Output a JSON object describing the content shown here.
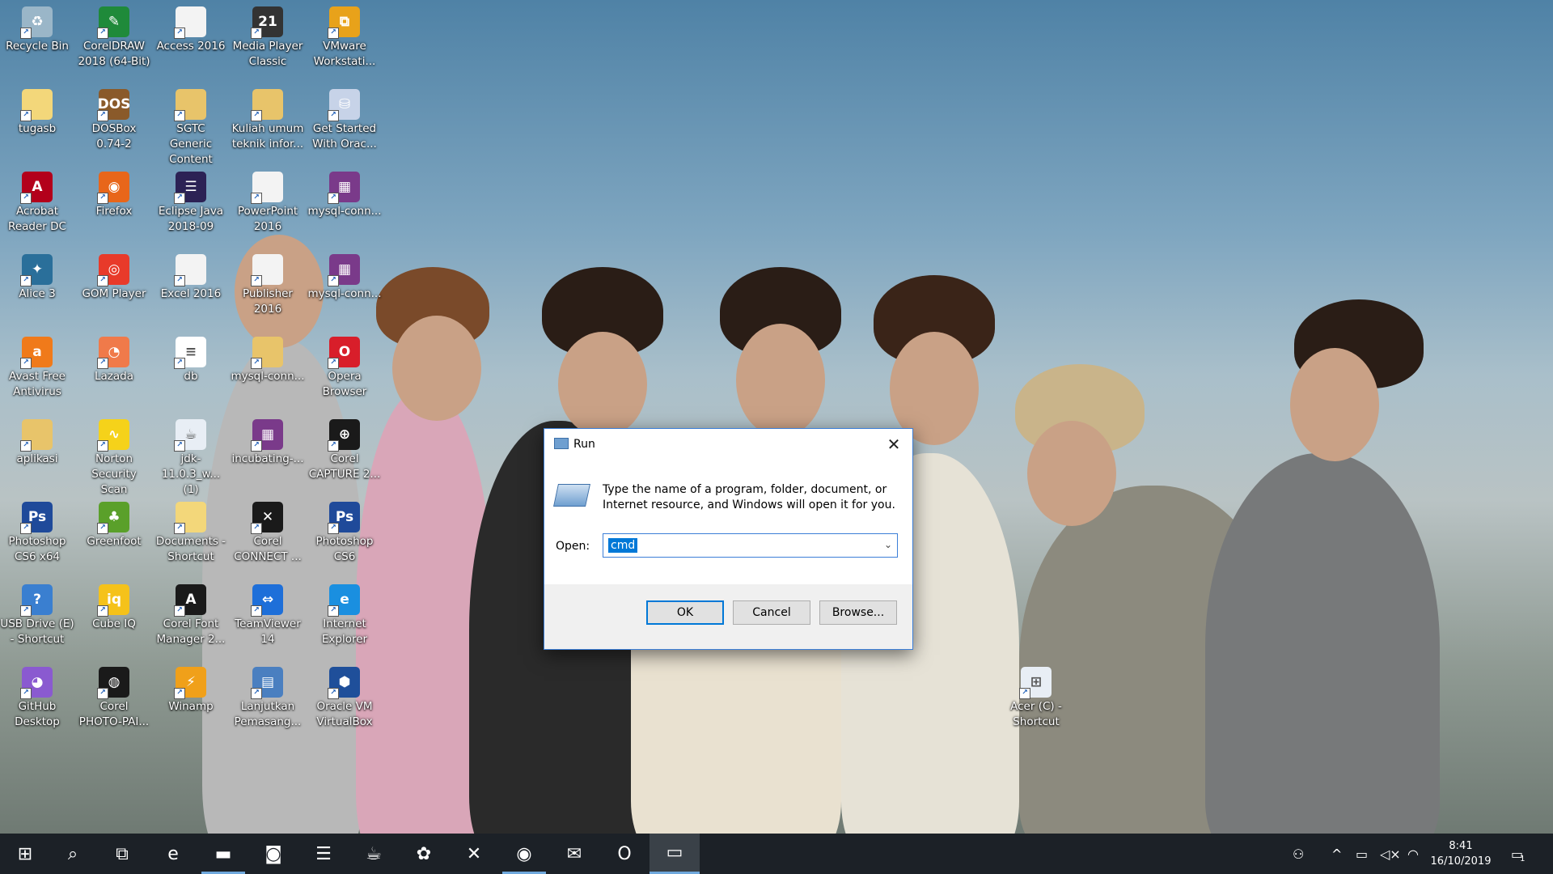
{
  "desktop_icons": [
    {
      "label": "Recycle Bin",
      "icon": "recycle-bin-icon",
      "color": "#9ab6c8",
      "glyph": "♻"
    },
    {
      "label": "CorelDRAW\n2018 (64-Bit)",
      "icon": "coreldraw-icon",
      "color": "#1f8a3a",
      "glyph": "✎"
    },
    {
      "label": "Access 2016",
      "icon": "document-icon",
      "color": "#f3f3f3",
      "glyph": ""
    },
    {
      "label": "Media Player\nClassic",
      "icon": "media-player-icon",
      "color": "#333333",
      "glyph": "21"
    },
    {
      "label": "VMware\nWorkstati...",
      "icon": "vmware-icon",
      "color": "#e8a21a",
      "glyph": "⧉"
    },
    {
      "label": "tugasb",
      "icon": "folder-icon",
      "color": "#f3d77a",
      "glyph": ""
    },
    {
      "label": "DOSBox\n0.74-2",
      "icon": "dosbox-icon",
      "color": "#8a5a2a",
      "glyph": "DOS"
    },
    {
      "label": "SGTC Generic\nContent",
      "icon": "archive-icon",
      "color": "#e8c46a",
      "glyph": ""
    },
    {
      "label": "Kuliah umum\nteknik infor...",
      "icon": "archive-icon",
      "color": "#e8c46a",
      "glyph": ""
    },
    {
      "label": "Get Started\nWith Orac...",
      "icon": "database-icon",
      "color": "#c7d3e8",
      "glyph": "⛁"
    },
    {
      "label": "Acrobat\nReader DC",
      "icon": "acrobat-icon",
      "color": "#b3001b",
      "glyph": "A"
    },
    {
      "label": "Firefox",
      "icon": "firefox-icon",
      "color": "#e8661a",
      "glyph": "◉"
    },
    {
      "label": "Eclipse Java\n2018-09",
      "icon": "eclipse-icon",
      "color": "#2c2255",
      "glyph": "☰"
    },
    {
      "label": "PowerPoint\n2016",
      "icon": "document-icon",
      "color": "#f3f3f3",
      "glyph": ""
    },
    {
      "label": "mysql-conn...",
      "icon": "winrar-icon",
      "color": "#7a3a8a",
      "glyph": "▦"
    },
    {
      "label": "Alice 3",
      "icon": "alice-icon",
      "color": "#2a6f9a",
      "glyph": "✦"
    },
    {
      "label": "GOM Player",
      "icon": "gom-player-icon",
      "color": "#e83a2a",
      "glyph": "◎"
    },
    {
      "label": "Excel 2016",
      "icon": "document-icon",
      "color": "#f3f3f3",
      "glyph": ""
    },
    {
      "label": "Publisher\n2016",
      "icon": "document-icon",
      "color": "#f3f3f3",
      "glyph": ""
    },
    {
      "label": "mysql-conn...",
      "icon": "winrar-icon",
      "color": "#7a3a8a",
      "glyph": "▦"
    },
    {
      "label": "Avast Free\nAntivirus",
      "icon": "avast-icon",
      "color": "#f07a1a",
      "glyph": "a"
    },
    {
      "label": "Lazada",
      "icon": "lazada-icon",
      "color": "#f07a4a",
      "glyph": "◔"
    },
    {
      "label": "db",
      "icon": "text-file-icon",
      "color": "#ffffff",
      "glyph": "≡"
    },
    {
      "label": "mysql-conn...",
      "icon": "archive-icon",
      "color": "#e8c46a",
      "glyph": ""
    },
    {
      "label": "Opera\nBrowser",
      "icon": "opera-icon",
      "color": "#d81e2a",
      "glyph": "O"
    },
    {
      "label": "aplikasi",
      "icon": "archive-icon",
      "color": "#e8c46a",
      "glyph": ""
    },
    {
      "label": "Norton\nSecurity Scan",
      "icon": "norton-icon",
      "color": "#f5d21a",
      "glyph": "∿"
    },
    {
      "label": "jdk-11.0.3_w...\n(1)",
      "icon": "java-icon",
      "color": "#e8eef5",
      "glyph": "☕"
    },
    {
      "label": "incubating-...",
      "icon": "winrar-icon",
      "color": "#7a3a8a",
      "glyph": "▦"
    },
    {
      "label": "Corel\nCAPTURE 2...",
      "icon": "corel-capture-icon",
      "color": "#1a1a1a",
      "glyph": "⊕"
    },
    {
      "label": "Photoshop\nCS6 x64",
      "icon": "photoshop-icon",
      "color": "#1f4a9a",
      "glyph": "Ps"
    },
    {
      "label": "Greenfoot",
      "icon": "greenfoot-icon",
      "color": "#5aa02a",
      "glyph": "♣"
    },
    {
      "label": "Documents -\nShortcut",
      "icon": "documents-icon",
      "color": "#f3d77a",
      "glyph": ""
    },
    {
      "label": "Corel\nCONNECT ...",
      "icon": "corel-connect-icon",
      "color": "#1a1a1a",
      "glyph": "✕"
    },
    {
      "label": "Photoshop\nCS6",
      "icon": "photoshop-icon",
      "color": "#1f4a9a",
      "glyph": "Ps"
    },
    {
      "label": "USB Drive (E)\n- Shortcut",
      "icon": "usb-drive-icon",
      "color": "#3a7fd0",
      "glyph": "?"
    },
    {
      "label": "Cube IQ",
      "icon": "cube-iq-icon",
      "color": "#f5c21a",
      "glyph": "iq"
    },
    {
      "label": "Corel Font\nManager 2...",
      "icon": "corel-font-icon",
      "color": "#1a1a1a",
      "glyph": "A"
    },
    {
      "label": "TeamViewer\n14",
      "icon": "teamviewer-icon",
      "color": "#1e6fd9",
      "glyph": "⇔"
    },
    {
      "label": "Internet\nExplorer",
      "icon": "internet-explorer-icon",
      "color": "#1a8fe0",
      "glyph": "e"
    },
    {
      "label": "GitHub\nDesktop",
      "icon": "github-icon",
      "color": "#8a5ad0",
      "glyph": "◕"
    },
    {
      "label": "Corel\nPHOTO-PAI...",
      "icon": "corel-photopaint-icon",
      "color": "#1a1a1a",
      "glyph": "◍"
    },
    {
      "label": "Winamp",
      "icon": "winamp-icon",
      "color": "#f0a01a",
      "glyph": "⚡"
    },
    {
      "label": "Lanjutkan\nPemasang...",
      "icon": "installer-icon",
      "color": "#4a7fc0",
      "glyph": "▤"
    },
    {
      "label": "Oracle VM\nVirtualBox",
      "icon": "virtualbox-icon",
      "color": "#1f4f9a",
      "glyph": "⬢"
    },
    {
      "label": "Acer (C) -\nShortcut",
      "icon": "drive-icon",
      "color": "#e8eef5",
      "glyph": "⊞"
    }
  ],
  "run_dialog": {
    "title": "Run",
    "description": "Type the name of a program, folder, document, or Internet resource, and Windows will open it for you.",
    "open_label": "Open:",
    "open_value": "cmd",
    "ok_label": "OK",
    "cancel_label": "Cancel",
    "browse_label": "Browse..."
  },
  "taskbar": {
    "items": [
      {
        "name": "start-button",
        "icon": "windows-icon",
        "glyph": "⊞"
      },
      {
        "name": "search-button",
        "icon": "search-icon",
        "glyph": "⌕"
      },
      {
        "name": "task-view-button",
        "icon": "task-view-icon",
        "glyph": "⧉"
      },
      {
        "name": "taskbar-internet-explorer",
        "icon": "internet-explorer-icon",
        "glyph": "e"
      },
      {
        "name": "taskbar-file-explorer",
        "icon": "folder-icon",
        "glyph": "▬"
      },
      {
        "name": "taskbar-camera",
        "icon": "camera-icon",
        "glyph": "◙"
      },
      {
        "name": "taskbar-eclipse",
        "icon": "eclipse-icon",
        "glyph": "☰"
      },
      {
        "name": "taskbar-java",
        "icon": "java-icon",
        "glyph": "☕"
      },
      {
        "name": "taskbar-app",
        "icon": "app-icon",
        "glyph": "✿"
      },
      {
        "name": "taskbar-xampp",
        "icon": "xampp-icon",
        "glyph": "✕"
      },
      {
        "name": "taskbar-chrome",
        "icon": "chrome-icon",
        "glyph": "◉"
      },
      {
        "name": "taskbar-mail",
        "icon": "mail-icon",
        "glyph": "✉"
      },
      {
        "name": "taskbar-opera",
        "icon": "opera-icon",
        "glyph": "O"
      },
      {
        "name": "taskbar-run",
        "icon": "run-icon",
        "glyph": "▭"
      }
    ],
    "time": "8:41",
    "date": "16/10/2019",
    "notification_count": "1"
  }
}
